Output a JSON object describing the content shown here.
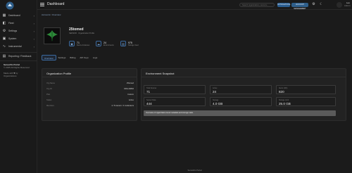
{
  "app": {
    "brand_color": "#3b6aa0",
    "accent": "#7fb0ea"
  },
  "sidebar": {
    "items": [
      {
        "label": "Dashboard",
        "icon": "grid-icon",
        "chevron": "›"
      },
      {
        "label": "Fleet",
        "icon": "layers-icon",
        "chevron": "›"
      },
      {
        "label": "Settings",
        "icon": "gear-icon",
        "chevron": "›"
      },
      {
        "label": "System",
        "icon": "cpu-icon",
        "chevron": "›"
      },
      {
        "label": "Instrumental",
        "icon": "wave-icon",
        "chevron": "›"
      }
    ],
    "feedback_label": "Reporting / Feedback",
    "footer": {
      "company": "SensoFlo Portal",
      "copyright": "© 2025 All Rights Reserved",
      "made_with_prefix": "Made with",
      "made_with_suffix": "by",
      "made_by": "Organizations"
    }
  },
  "topbar": {
    "title": "Dashboard",
    "search_placeholder": "Search organizations, sensors...",
    "pill_a": "NOTIFICATIONS",
    "pill_b": "ACCOUNT MANAGEMENT",
    "user_name": "Leo",
    "user_role": "Admin"
  },
  "breadcrumb": {
    "root": "Accounts",
    "sep": " / ",
    "current": "Overview"
  },
  "org": {
    "name": "25tomed",
    "subtitle": "SENSOR · Organization Profile",
    "stats": [
      {
        "value": "71",
        "label": "Device Instances",
        "icon": "device-icon"
      },
      {
        "value": "24",
        "label": "Environments",
        "icon": "cloud-icon"
      },
      {
        "value": "975",
        "label": "Storage Used",
        "icon": "disk-icon"
      }
    ]
  },
  "tabs": [
    "Overview",
    "Settings",
    "Billing",
    "API Keys",
    "Logs"
  ],
  "profile_card": {
    "title": "Organization Profile",
    "rows": [
      {
        "k": "Org Name",
        "v": "25tomed"
      },
      {
        "k": "Org ID",
        "v": "ORG-00832"
      },
      {
        "k": "Plan",
        "v": "Custom"
      },
      {
        "k": "Status",
        "v": "Active"
      },
      {
        "k": "Members",
        "v": "4 / 8 owners / 3 moderators"
      }
    ]
  },
  "snapshot_card": {
    "title": "Environment Snapshot",
    "tiles": [
      {
        "label": "Total Devices",
        "value": "71"
      },
      {
        "label": "Active",
        "value": "24"
      },
      {
        "label": "Alerts (24h)",
        "value": "820"
      },
      {
        "label": "Sensor Data",
        "value": "444"
      },
      {
        "label": "Storage",
        "value": "4.0 GB"
      },
      {
        "label": "Storage Limit",
        "value": "25.0 GB"
      }
    ],
    "note": "Overview of organization-level metadata and storage stats."
  },
  "footer_text": "SensoFlo Portal"
}
